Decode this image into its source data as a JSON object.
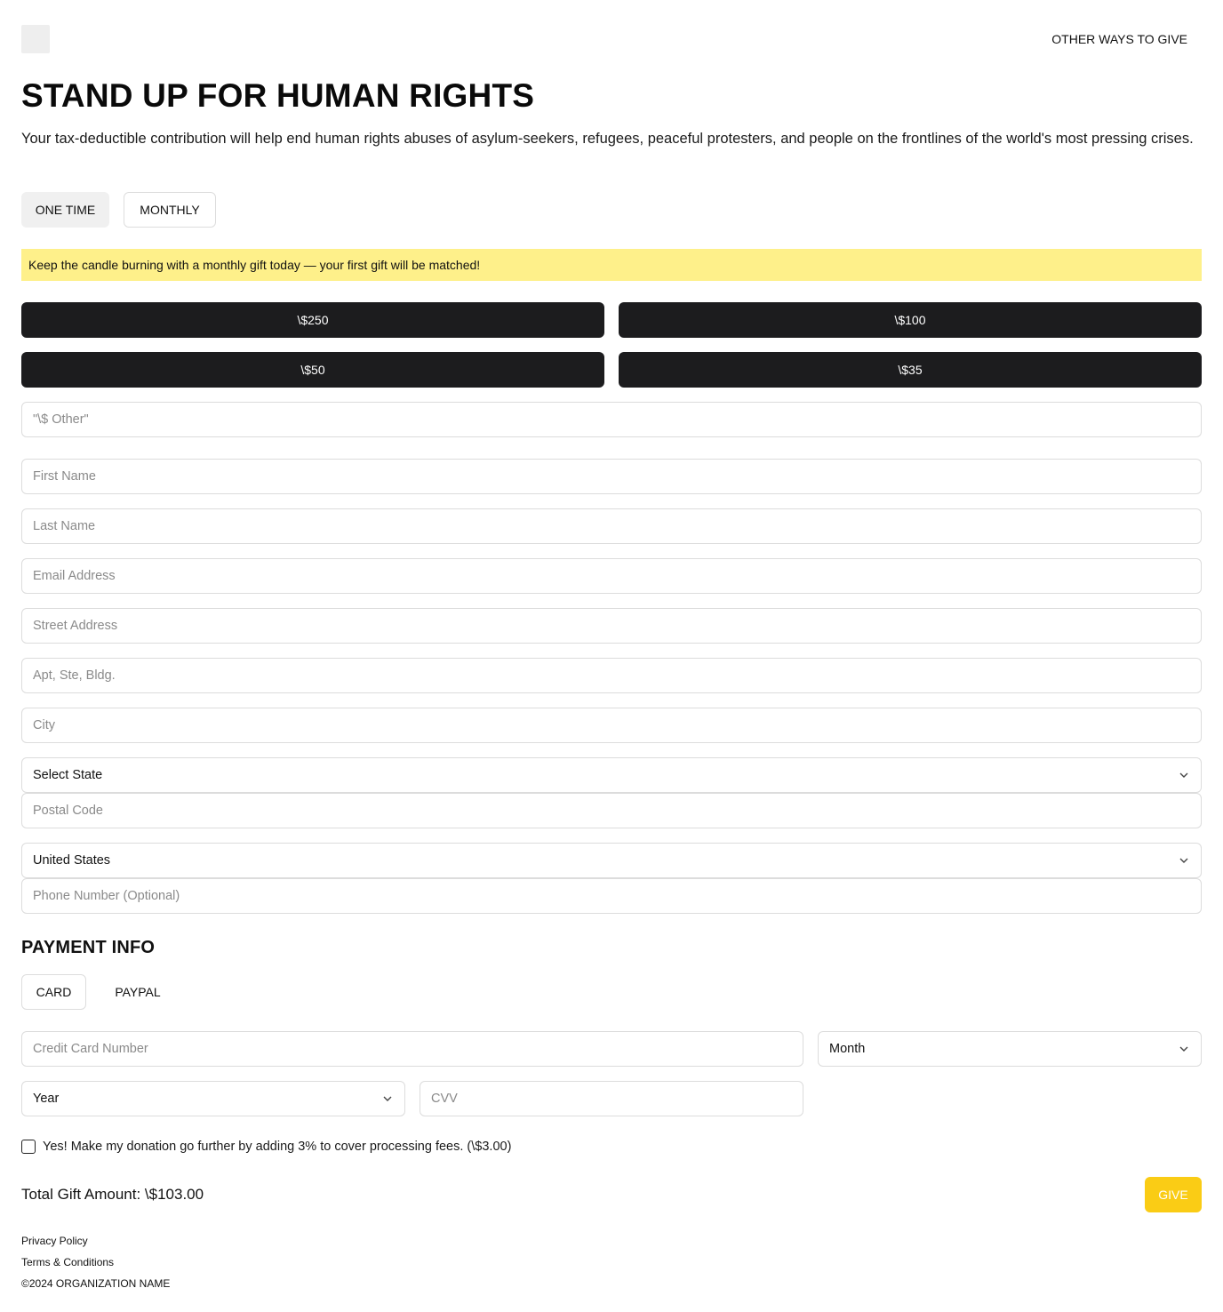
{
  "header": {
    "logo_icon": "logo-placeholder",
    "other_ways": "OTHER WAYS TO GIVE"
  },
  "hero": {
    "title": "STAND UP FOR HUMAN RIGHTS",
    "subtitle": "Your tax-deductible contribution will help end human rights abuses of asylum-seekers, refugees, peaceful protesters, and people on the frontlines of the world's most pressing crises."
  },
  "frequency": {
    "one_time": "ONE TIME",
    "monthly": "MONTHLY",
    "selected": "ONE TIME"
  },
  "banner": {
    "text": "Keep the candle burning with a monthly gift today — your first gift will be matched!",
    "color": "#fef08a"
  },
  "amounts": [
    "\\$250",
    "\\$100",
    "\\$50",
    "\\$35"
  ],
  "other_amount": {
    "placeholder": "\"\\$ Other\""
  },
  "form": {
    "first_name": "First Name",
    "last_name": "Last Name",
    "email": "Email Address",
    "street": "Street Address",
    "apt": "Apt, Ste, Bldg.",
    "city": "City",
    "state": "Select State",
    "postal": "Postal Code",
    "country": "United States",
    "phone": "Phone Number (Optional)"
  },
  "payment": {
    "heading": "PAYMENT INFO",
    "tab_card": "CARD",
    "tab_paypal": "PAYPAL",
    "selected_tab": "CARD",
    "card_number": "Credit Card Number",
    "month": "Month",
    "year": "Year",
    "cvv": "CVV"
  },
  "fees": {
    "label": "Yes! Make my donation go further by adding 3% to cover processing fees. (\\$3.00)",
    "checked": false
  },
  "total": {
    "label": "Total Gift Amount: \\$103.00"
  },
  "give_button": {
    "label": "GIVE",
    "color": "#facc15"
  },
  "footer": {
    "privacy": "Privacy Policy",
    "terms": "Terms & Conditions",
    "copyright": "©2024 ORGANIZATION NAME"
  },
  "colors": {
    "amount_button": "#1c1c1e",
    "border": "#dcdcdc"
  }
}
